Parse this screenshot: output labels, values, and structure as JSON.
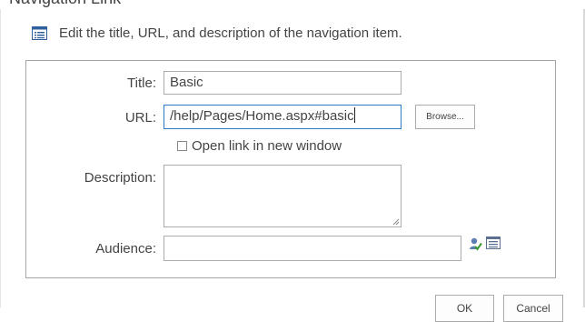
{
  "dialog": {
    "title": "Navigation Link"
  },
  "header": {
    "instruction": "Edit the title, URL, and description of the navigation item."
  },
  "form": {
    "title_label": "Title:",
    "title_value": "Basic",
    "url_label": "URL:",
    "url_value": "/help/Pages/Home.aspx#basic",
    "browse_label": "Browse...",
    "new_window_label": "Open link in new window",
    "new_window_checked": false,
    "description_label": "Description:",
    "description_value": "",
    "audience_label": "Audience:",
    "audience_value": ""
  },
  "buttons": {
    "ok_label": "OK",
    "cancel_label": "Cancel"
  },
  "icons": {
    "header": "list-icon",
    "audience_check": "check-names-icon",
    "audience_browse": "address-book-icon"
  },
  "colors": {
    "focus_border": "#2b79c9",
    "border": "#ababab",
    "text": "#444444"
  }
}
